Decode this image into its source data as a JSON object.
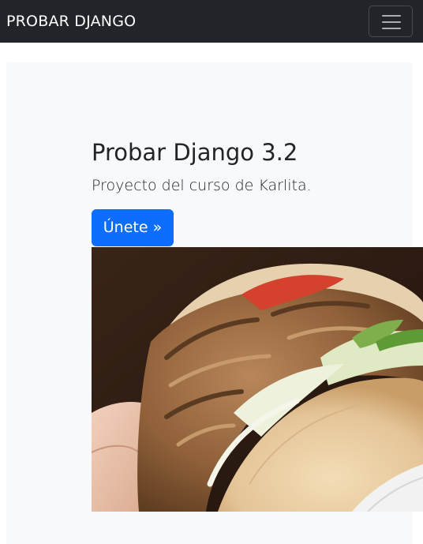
{
  "navbar": {
    "brand": "PROBAR DJANGO",
    "toggler_icon": "hamburger-menu-icon"
  },
  "hero": {
    "title": "Probar Django 3.2",
    "lead": "Proyecto del curso de Karlita.",
    "cta_label": "Únete »"
  },
  "colors": {
    "navbar_bg": "#212529",
    "jumbotron_bg": "#f8f9fa",
    "primary": "#0d6efd",
    "text": "#212529"
  }
}
